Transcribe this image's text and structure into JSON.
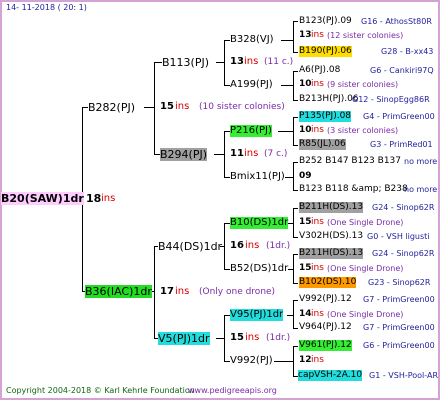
{
  "header": {
    "date": "14- 11-2018 ( 20: 1)"
  },
  "footer": {
    "copyright": "Copyright 2004-2018 © Karl Kehrle Foundation",
    "site": "www.pedigreeapis.org"
  },
  "colors": {
    "frame": "#d4a3d4",
    "pink": "#ffccff",
    "green": "#22dd22",
    "gray": "#a0a0a0",
    "yellow": "#ffdd00",
    "cyan": "#22dddd",
    "orange": "#ff9900",
    "red": "#d40000",
    "blue": "#1f1f9a",
    "purple": "#7a2aa8"
  },
  "queen": {
    "name": "B20(SAW)1dr",
    "ins_num": "18",
    "ins_word": "ins"
  },
  "gen1": [
    {
      "name": "B282(PJ)",
      "ins_num": "15",
      "ins_word": "ins",
      "note": "(10 sister colonies)"
    },
    {
      "name": "B36(IAC)1dr",
      "ins_num": "17",
      "ins_word": "ins",
      "note": "(Only one drone)"
    }
  ],
  "gen2": [
    {
      "name": "B113(PJ)"
    },
    {
      "name": "B294(PJ)"
    },
    {
      "name": "B44(DS)1dr",
      "ins_num": "16",
      "ins_word": "ins",
      "note": "(1dr.)"
    },
    {
      "name": "V5(PJ)1dr",
      "ins_num": "15",
      "ins_word": "ins",
      "note": "(1dr.)"
    }
  ],
  "gen3": [
    {
      "name": "B328(VJ)",
      "ins_num": "13",
      "ins_word": "ins",
      "note": "(11 c.)"
    },
    {
      "name": "A199(PJ)"
    },
    {
      "name": "P216(PJ)",
      "ins_num": "11",
      "ins_word": "ins",
      "note": "(7 c.)"
    },
    {
      "name": "Bmix11(PJ)",
      "ins_num": "09"
    },
    {
      "name": "B10(DS)1dr"
    },
    {
      "name": "B52(DS)1dr"
    },
    {
      "name": "V95(PJ)1dr"
    },
    {
      "name": "V992(PJ)"
    }
  ],
  "gen4": [
    {
      "name": "B123(PJ).09",
      "line": "G16 - AthosSt80R",
      "ins_num": "11",
      "ins_word": "ins",
      "note": "(12 sister colonies)"
    },
    {
      "name": "B190(PJ).06",
      "line": "G28 - B-xx43"
    },
    {
      "name": "A6(PJ).08",
      "line": "G6 - Cankiri97Q",
      "ins_num": "10",
      "ins_word": "ins",
      "note": "(9 sister colonies)"
    },
    {
      "name": "B213H(PJ).06",
      "line": "G12 - SinopEgg86R"
    },
    {
      "name": "P135(PJ).08",
      "line": "G4 - PrimGreen00",
      "ins_num": "10",
      "ins_word": "ins",
      "note": "(3 sister colonies)"
    },
    {
      "name": "R85(JL).06",
      "line": "G3 - PrimRed01"
    },
    {
      "name": "B252 B147 B123 B137",
      "line": "no more",
      "ins_num": "09"
    },
    {
      "name": "B123 B118 &amp; B238",
      "line": "no more"
    },
    {
      "name": "B211H(DS).13",
      "line": "G24 - Sinop62R",
      "ins_num": "15",
      "ins_word": "ins",
      "note": "(One Single Drone)"
    },
    {
      "name": "V302H(DS).13",
      "line": "G0 - VSH ligusti"
    },
    {
      "name": "B211H(DS).13",
      "line": "G24 - Sinop62R",
      "ins_num": "15",
      "ins_word": "ins",
      "note": "(One Single Drone)"
    },
    {
      "name": "B102(DS).10",
      "line": "G23 - Sinop62R"
    },
    {
      "name": "V992(PJ).12",
      "line": "G7 - PrimGreen00",
      "ins_num": "14",
      "ins_word": "ins",
      "note": "(One Single Drone)"
    },
    {
      "name": "V964(PJ).12",
      "line": "G7 - PrimGreen00"
    },
    {
      "name": "V961(PJ).12",
      "line": "G6 - PrimGreen00",
      "ins_num": "12",
      "ins_word": "ins"
    },
    {
      "name": "capVSH-2A.10",
      "line": "G1 - VSH-Pool-AR"
    }
  ]
}
